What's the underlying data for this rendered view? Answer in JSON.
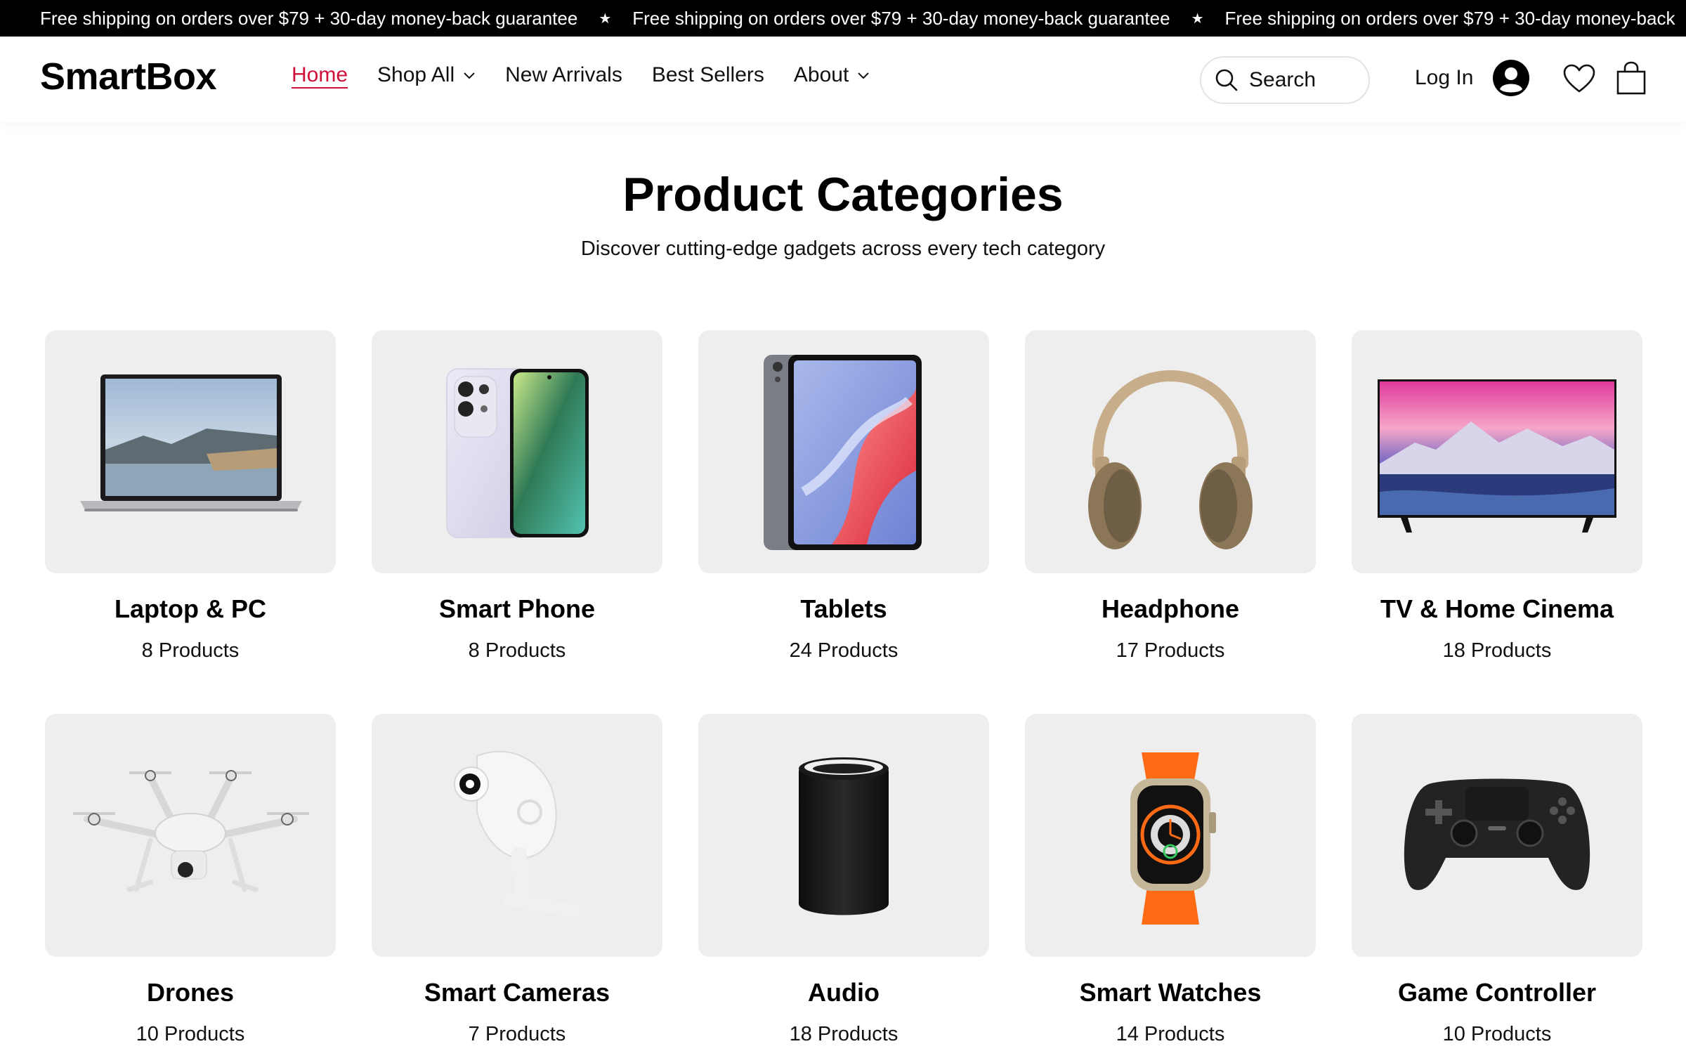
{
  "announcement": {
    "items": [
      "Free shipping on orders over $79 + 30-day money-back guarantee",
      "Free shipping on orders over $79 + 30-day money-back guarantee",
      "Free shipping on orders over $79 + 30-day money-back"
    ],
    "separator": "★"
  },
  "header": {
    "logo": "SmartBox",
    "nav": [
      {
        "label": "Home",
        "active": true
      },
      {
        "label": "Shop All",
        "dropdown": true
      },
      {
        "label": "New Arrivals"
      },
      {
        "label": "Best Sellers"
      },
      {
        "label": "About",
        "dropdown": true
      }
    ],
    "search": {
      "placeholder": "Search"
    },
    "login_label": "Log In",
    "icons": [
      "search-icon",
      "user-avatar-icon",
      "heart-icon",
      "shopping-bag-icon"
    ]
  },
  "section": {
    "title": "Product Categories",
    "subtitle": "Discover cutting-edge gadgets across every tech category"
  },
  "categories": [
    {
      "name": "Laptop & PC",
      "count": "8 Products",
      "icon": "laptop-image"
    },
    {
      "name": "Smart Phone",
      "count": "8 Products",
      "icon": "smartphone-image"
    },
    {
      "name": "Tablets",
      "count": "24 Products",
      "icon": "tablet-image"
    },
    {
      "name": "Headphone",
      "count": "17 Products",
      "icon": "headphone-image"
    },
    {
      "name": "TV & Home Cinema",
      "count": "18 Products",
      "icon": "tv-image"
    },
    {
      "name": "Drones",
      "count": "10 Products",
      "icon": "drone-image"
    },
    {
      "name": "Smart Cameras",
      "count": "7 Products",
      "icon": "camera-image"
    },
    {
      "name": "Audio",
      "count": "18 Products",
      "icon": "speaker-image"
    },
    {
      "name": "Smart Watches",
      "count": "14 Products",
      "icon": "smartwatch-image"
    },
    {
      "name": "Game Controller",
      "count": "10 Products",
      "icon": "gamepad-image"
    }
  ],
  "colors": {
    "accent": "#d0103a",
    "announcement_bg": "#000000",
    "card_bg": "#efeeee"
  }
}
